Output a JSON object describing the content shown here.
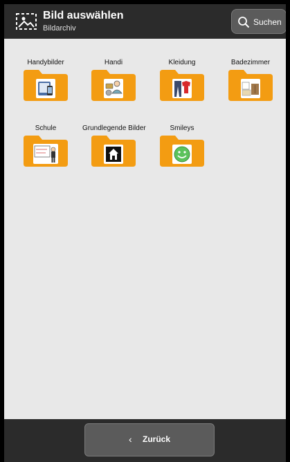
{
  "header": {
    "title": "Bild auswählen",
    "subtitle": "Bildarchiv",
    "icon": "image-select-icon",
    "search_label": "Suchen"
  },
  "folders": [
    {
      "label": "Handybilder",
      "icon": "phone-tablet-icon"
    },
    {
      "label": "Handi",
      "icon": "person-shopping-icon"
    },
    {
      "label": "Kleidung",
      "icon": "clothing-icon"
    },
    {
      "label": "Badezimmer",
      "icon": "bathroom-icon"
    },
    {
      "label": "Schule",
      "icon": "school-board-icon"
    },
    {
      "label": "Grundlegende Bilder",
      "icon": "house-icon"
    },
    {
      "label": "Smileys",
      "icon": "smiley-icon"
    }
  ],
  "footer": {
    "back_label": "Zurück",
    "back_icon": "chevron-left-icon"
  },
  "colors": {
    "header_bg": "#2b2b2b",
    "button_bg": "#5b5b5b",
    "folder": "#f39c12",
    "content_bg": "#e8e8e8"
  }
}
